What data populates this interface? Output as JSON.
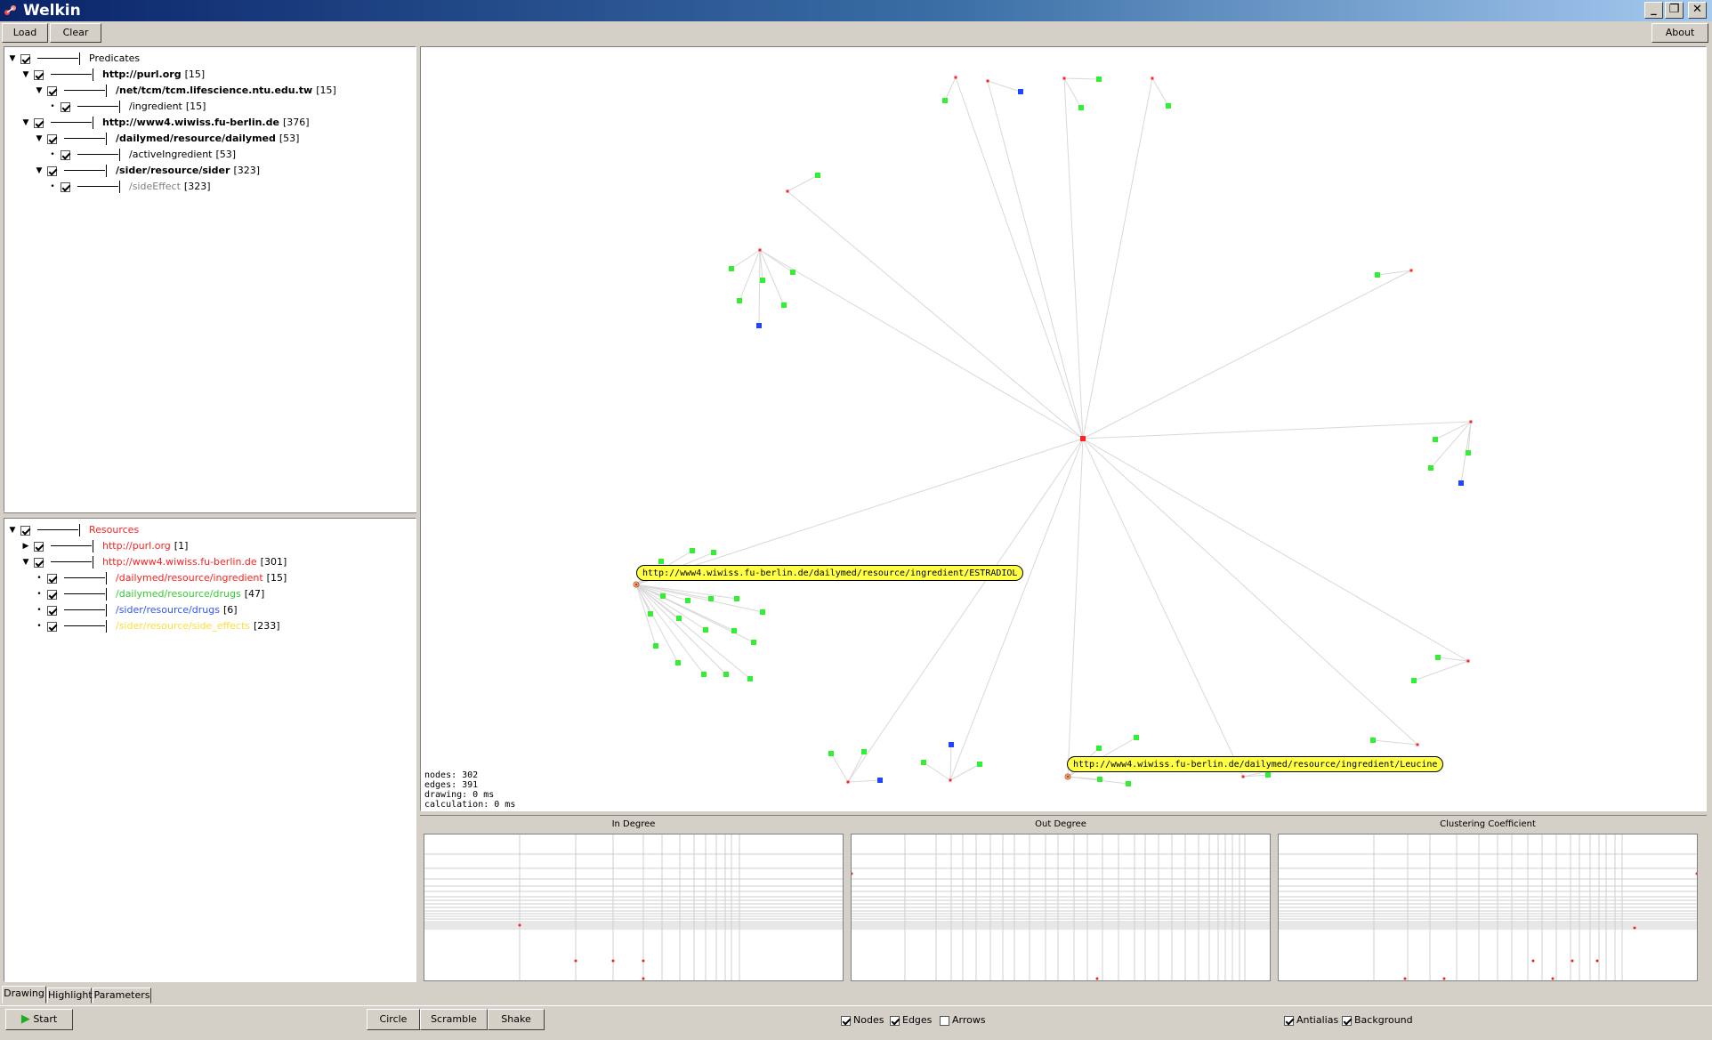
{
  "window": {
    "title": "Welkin"
  },
  "toolbar": {
    "load": "Load",
    "clear": "Clear",
    "about": "About"
  },
  "predicates_tree": [
    {
      "label": "Predicates",
      "count": "",
      "level": 0,
      "bold": false,
      "color": "#000000",
      "expander": "▼"
    },
    {
      "label": "http://purl.org",
      "count": "[15]",
      "level": 1,
      "bold": true,
      "color": "#000000",
      "expander": "▼"
    },
    {
      "label": "/net/tcm/tcm.lifescience.ntu.edu.tw",
      "count": "[15]",
      "level": 2,
      "bold": true,
      "color": "#000000",
      "expander": "▼"
    },
    {
      "label": "/ingredient",
      "count": "[15]",
      "level": 3,
      "bold": false,
      "color": "#000000",
      "expander": "•"
    },
    {
      "label": "http://www4.wiwiss.fu-berlin.de",
      "count": "[376]",
      "level": 1,
      "bold": true,
      "color": "#000000",
      "expander": "▼"
    },
    {
      "label": "/dailymed/resource/dailymed",
      "count": "[53]",
      "level": 2,
      "bold": true,
      "color": "#000000",
      "expander": "▼"
    },
    {
      "label": "/activeIngredient",
      "count": "[53]",
      "level": 3,
      "bold": false,
      "color": "#000000",
      "expander": "•"
    },
    {
      "label": "/sider/resource/sider",
      "count": "[323]",
      "level": 2,
      "bold": true,
      "color": "#000000",
      "expander": "▼"
    },
    {
      "label": "/sideEffect",
      "count": "[323]",
      "level": 3,
      "bold": false,
      "color": "#808080",
      "expander": "•"
    }
  ],
  "resources_tree": [
    {
      "label": "Resources",
      "count": "",
      "level": 0,
      "color": "#ff2020",
      "expander": "▼"
    },
    {
      "label": "http://purl.org",
      "count": "[1]",
      "level": 1,
      "color": "#ff2020",
      "expander": "▶"
    },
    {
      "label": "http://www4.wiwiss.fu-berlin.de",
      "count": "[301]",
      "level": 1,
      "color": "#ff2020",
      "expander": "▼"
    },
    {
      "label": "/dailymed/resource/ingredient",
      "count": "[15]",
      "level": 2,
      "color": "#ff2020",
      "expander": "•"
    },
    {
      "label": "/dailymed/resource/drugs",
      "count": "[47]",
      "level": 2,
      "color": "#33cc33",
      "expander": "•"
    },
    {
      "label": "/sider/resource/drugs",
      "count": "[6]",
      "level": 2,
      "color": "#3355ff",
      "expander": "•"
    },
    {
      "label": "/sider/resource/side_effects",
      "count": "[233]",
      "level": 2,
      "color": "#ffdd33",
      "expander": "•"
    }
  ],
  "graph": {
    "tooltips": {
      "estradiol": "http://www4.wiwiss.fu-berlin.de/dailymed/resource/ingredient/ESTRADIOL",
      "leucine": "http://www4.wiwiss.fu-berlin.de/dailymed/resource/ingredient/Leucine"
    },
    "stats": {
      "nodes": "nodes: 302",
      "edges": "edges: 391",
      "drawing": "drawing: 0 ms",
      "calculation": "calculation: 0 ms"
    },
    "colors": {
      "hub": "#ff2222",
      "drug": "#33ee33",
      "sider_drug": "#2244ff",
      "edge": "#d8d8d8"
    }
  },
  "charts": {
    "in_degree": "In Degree",
    "out_degree": "Out Degree",
    "clustering": "Clustering Coefficient"
  },
  "tabs": {
    "drawing": "Drawing",
    "highlight": "Highlight",
    "parameters": "Parameters"
  },
  "controls": {
    "start": "Start",
    "circle": "Circle",
    "scramble": "Scramble",
    "shake": "Shake",
    "nodes": "Nodes",
    "edges": "Edges",
    "arrows": "Arrows",
    "antialias": "Antialias",
    "background": "Background"
  },
  "checks": {
    "nodes": true,
    "edges": true,
    "arrows": false,
    "antialias": true,
    "background": true
  }
}
